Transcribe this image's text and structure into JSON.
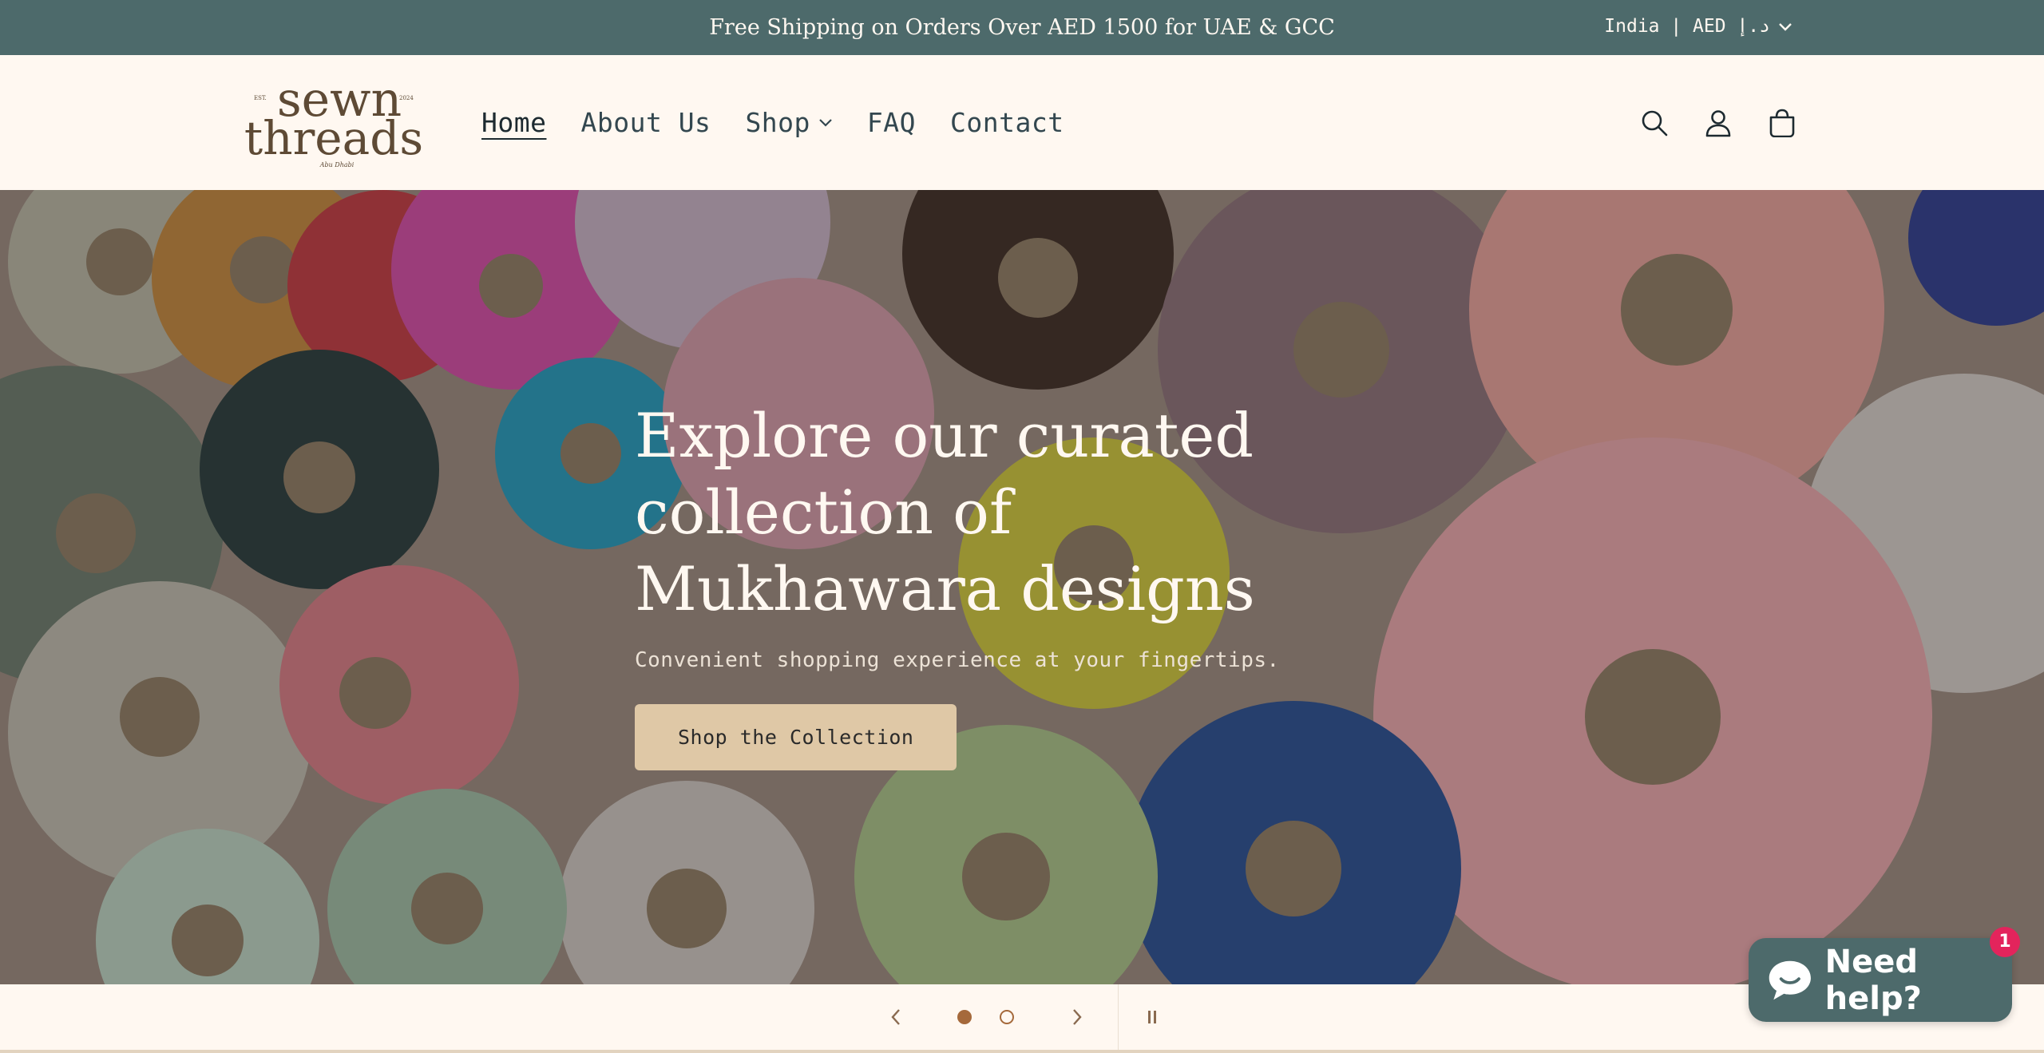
{
  "announcement": {
    "message": "Free Shipping on Orders Over AED 1500 for UAE & GCC",
    "locale": "India | AED د.إ",
    "locale_icon": "chevron-down-icon"
  },
  "header": {
    "logo": {
      "line1": "sewn",
      "line2": "threads",
      "est": "EST.",
      "year": "2024",
      "city": "Abu Dhabi"
    },
    "nav": [
      {
        "label": "Home",
        "active": true
      },
      {
        "label": "About Us"
      },
      {
        "label": "Shop",
        "icon": "chevron-down-icon"
      },
      {
        "label": "FAQ"
      },
      {
        "label": "Contact"
      }
    ],
    "icons": [
      "search-icon",
      "account-icon",
      "cart-icon"
    ]
  },
  "hero": {
    "title": "Explore our curated collection of Mukhawara designs",
    "subtitle": "Convenient shopping experience at your fingertips.",
    "cta_label": "Shop the Collection"
  },
  "slider": {
    "current_slide": 1,
    "total_slides": 2,
    "icons": [
      "chevron-left-icon",
      "chevron-right-icon",
      "pause-icon"
    ]
  },
  "chat": {
    "label": "Need help?",
    "badge_count": "1",
    "icon": "chat-bubble-icon"
  },
  "colors": {
    "announcement_bg": "#4d6a6b",
    "page_bg": "#fff8f1",
    "cta_bg": "#dfc8a6",
    "dot_accent": "#a5693b",
    "badge": "#e3245c"
  }
}
